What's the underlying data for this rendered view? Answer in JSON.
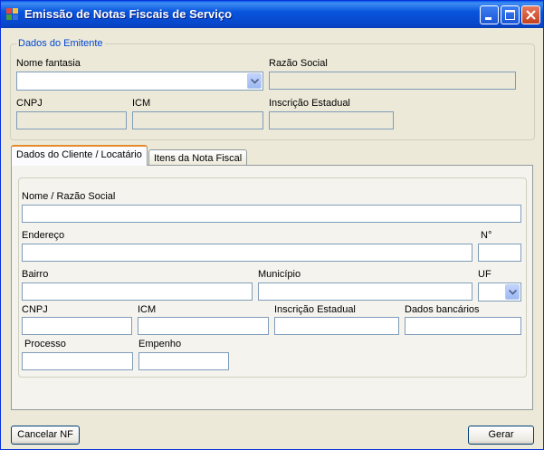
{
  "window": {
    "title": "Emissão de Notas Fiscais de Serviço",
    "controls": {
      "minimize_icon": "minimize-icon",
      "maximize_icon": "maximize-icon",
      "close_icon": "close-icon"
    }
  },
  "emitente": {
    "legend": "Dados do Emitente",
    "nome_fantasia_label": "Nome fantasia",
    "nome_fantasia_value": "",
    "razao_social_label": "Razão Social",
    "cnpj_label": "CNPJ",
    "icm_label": "ICM",
    "inscricao_label": "Inscrição Estadual"
  },
  "tabs": [
    {
      "label": "Dados do Cliente / Locatário",
      "active": true
    },
    {
      "label": "Itens da Nota Fiscal",
      "active": false
    }
  ],
  "cliente": {
    "nome_label": "Nome / Razão Social",
    "endereco_label": "Endereço",
    "numero_label": "N°",
    "bairro_label": "Bairro",
    "municipio_label": "Município",
    "uf_label": "UF",
    "cnpj_label": "CNPJ",
    "icm_label": "ICM",
    "inscricao_label": "Inscrição Estadual",
    "bancarios_label": "Dados bancários",
    "processo_label": "Processo",
    "empenho_label": "Empenho"
  },
  "buttons": {
    "cancelar": "Cancelar NF",
    "gerar": "Gerar"
  },
  "colors": {
    "title_bar": "#0855dd",
    "legend_text": "#0046d5",
    "active_tab_accent": "#e68b2c",
    "window_bg": "#ece9d8"
  }
}
